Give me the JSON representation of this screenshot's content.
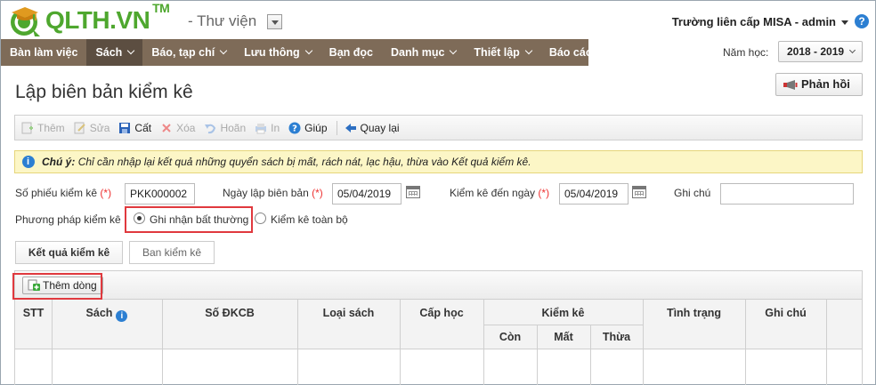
{
  "header": {
    "logo_text": "QLTH.VN",
    "logo_tm": "TM",
    "module_title": "- Thư viện",
    "user": "Trường liên cấp MISA - admin"
  },
  "nav": {
    "items": [
      {
        "label": "Bàn làm việc",
        "active": false,
        "dropdown": false
      },
      {
        "label": "Sách",
        "active": true,
        "dropdown": true
      },
      {
        "label": "Báo, tạp chí",
        "active": false,
        "dropdown": true
      },
      {
        "label": "Lưu thông",
        "active": false,
        "dropdown": true
      },
      {
        "label": "Bạn đọc",
        "active": false,
        "dropdown": false
      },
      {
        "label": "Danh mục",
        "active": false,
        "dropdown": true
      },
      {
        "label": "Thiết lập",
        "active": false,
        "dropdown": true
      },
      {
        "label": "Báo cáo",
        "active": false,
        "dropdown": false
      }
    ],
    "year_label": "Năm học:",
    "year_value": "2018 - 2019"
  },
  "page": {
    "title": "Lập biên bản kiểm kê",
    "feedback_label": "Phản hồi"
  },
  "toolbar": {
    "add": "Thêm",
    "edit": "Sửa",
    "save": "Cất",
    "delete": "Xóa",
    "undo": "Hoãn",
    "print": "In",
    "help": "Giúp",
    "back": "Quay lại"
  },
  "note": {
    "label": "Chú ý:",
    "text": "Chỉ cần nhập lại kết quả những quyển sách bị mất, rách nát, lạc hậu, thừa vào Kết quả kiểm kê."
  },
  "form": {
    "voucher_label": "Số phiếu kiểm kê",
    "voucher_value": "PKK000002",
    "date_label": "Ngày lập biên bản",
    "date_value": "05/04/2019",
    "to_date_label": "Kiểm kê đến ngày",
    "to_date_value": "05/04/2019",
    "note_label": "Ghi chú",
    "note_value": "",
    "method_label": "Phương pháp kiểm kê",
    "method_option_1": "Ghi nhận bất thường",
    "method_option_2": "Kiểm kê toàn bộ",
    "required_mark": "(*)"
  },
  "tabs": {
    "result": "Kết quả kiểm kê",
    "committee": "Ban kiểm kê"
  },
  "grid": {
    "add_row": "Thêm dòng",
    "headers": {
      "stt": "STT",
      "book": "Sách",
      "dkcb": "Số ĐKCB",
      "type": "Loại sách",
      "level": "Cấp học",
      "inventory": "Kiểm kê",
      "remain": "Còn",
      "lost": "Mất",
      "extra": "Thừa",
      "status": "Tình trạng",
      "note": "Ghi chú"
    }
  },
  "colors": {
    "nav_bg": "#7e6b58",
    "nav_active": "#5c4e41",
    "brand_green": "#4ea72e",
    "highlight_red": "#e0393e",
    "note_bg": "#fcf6c6"
  }
}
